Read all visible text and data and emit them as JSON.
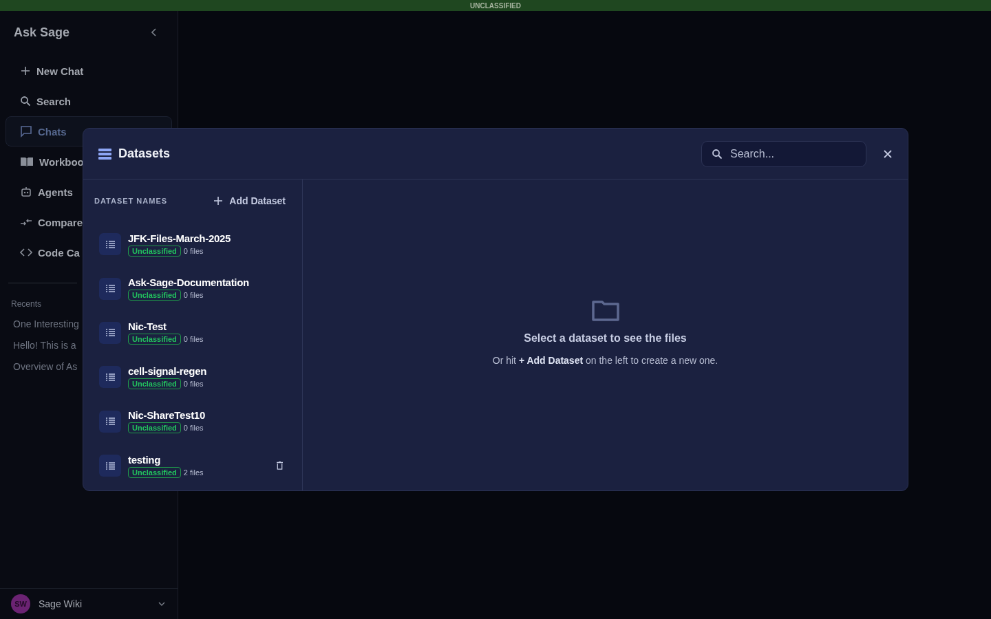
{
  "banner": {
    "text": "UNCLASSIFIED"
  },
  "sidebar": {
    "title": "Ask Sage",
    "actions": [
      {
        "kind": "plus",
        "label": "New Chat"
      },
      {
        "kind": "search",
        "label": "Search"
      }
    ],
    "items": [
      {
        "kind": "chat",
        "label": "Chats",
        "selected": true
      },
      {
        "kind": "book",
        "label": "Workboo",
        "selected": false
      },
      {
        "kind": "robot",
        "label": "Agents",
        "selected": false
      },
      {
        "kind": "compare",
        "label": "Compare",
        "selected": false
      },
      {
        "kind": "code",
        "label": "Code Ca",
        "selected": false
      }
    ],
    "recents_label": "Recents",
    "recents": [
      "One Interesting",
      "Hello! This is a",
      "Overview of As"
    ],
    "user": {
      "initials": "SW",
      "name": "Sage Wiki"
    }
  },
  "modal": {
    "title": "Datasets",
    "search": {
      "placeholder": "Search..."
    },
    "list_heading": "DATASET NAMES",
    "add_button": "Add Dataset",
    "datasets": [
      {
        "name": "JFK-Files-March-2025",
        "tag": "Unclassified",
        "count": "0 files",
        "deletable": false
      },
      {
        "name": "Ask-Sage-Documentation",
        "tag": "Unclassified",
        "count": "0 files",
        "deletable": false
      },
      {
        "name": "Nic-Test",
        "tag": "Unclassified",
        "count": "0 files",
        "deletable": false
      },
      {
        "name": "cell-signal-regen",
        "tag": "Unclassified",
        "count": "0 files",
        "deletable": false
      },
      {
        "name": "Nic-ShareTest10",
        "tag": "Unclassified",
        "count": "0 files",
        "deletable": false
      },
      {
        "name": "testing",
        "tag": "Unclassified",
        "count": "2 files",
        "deletable": true
      }
    ],
    "empty_title": "Select a dataset to see the files",
    "empty_hint": "Or hit **+ Add Dataset** on the left to create a new one."
  }
}
